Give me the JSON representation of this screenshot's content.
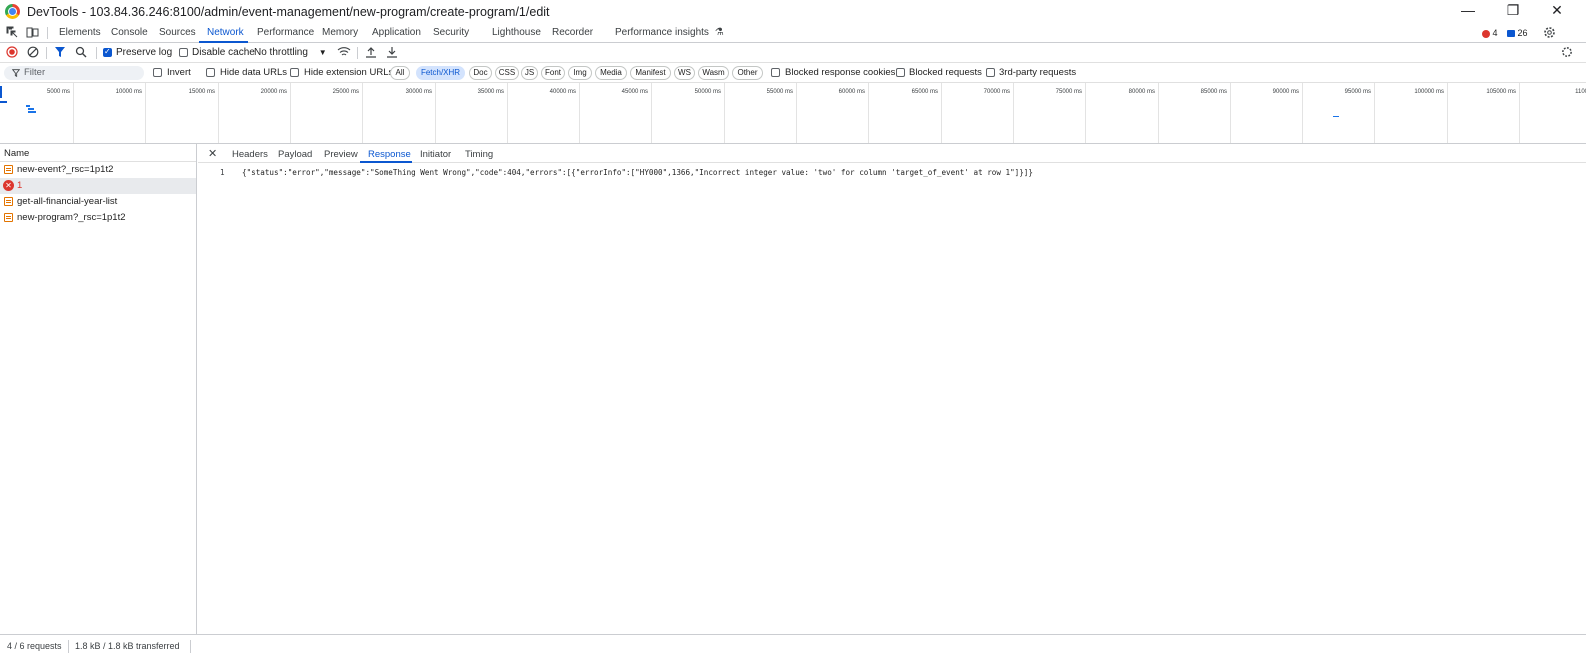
{
  "window": {
    "title": "DevTools - 103.84.36.246:8100/admin/event-management/new-program/create-program/1/edit",
    "minimize_glyph": "—",
    "restore_glyph": "❐",
    "close_glyph": "✕"
  },
  "main_tabs": [
    {
      "label": "Elements"
    },
    {
      "label": "Console"
    },
    {
      "label": "Sources"
    },
    {
      "label": "Network",
      "active": true
    },
    {
      "label": "Performance"
    },
    {
      "label": "Memory"
    },
    {
      "label": "Application"
    },
    {
      "label": "Security"
    },
    {
      "label": "Lighthouse"
    },
    {
      "label": "Recorder"
    },
    {
      "label": "Performance insights"
    }
  ],
  "badges": {
    "errors": "4",
    "messages": "26"
  },
  "toolbar": {
    "preserve_log": "Preserve log",
    "disable_cache": "Disable cache",
    "throttling": "No throttling"
  },
  "filter": {
    "placeholder": "Filter",
    "invert": "Invert",
    "hide_data_urls": "Hide data URLs",
    "hide_extension_urls": "Hide extension URLs",
    "types": [
      "All",
      "Fetch/XHR",
      "Doc",
      "CSS",
      "JS",
      "Font",
      "Img",
      "Media",
      "Manifest",
      "WS",
      "Wasm",
      "Other"
    ],
    "selected_type": "Fetch/XHR",
    "blocked_response_cookies": "Blocked response cookies",
    "blocked_requests": "Blocked requests",
    "third_party": "3rd-party requests"
  },
  "timeline_ticks": [
    "5000 ms",
    "10000 ms",
    "15000 ms",
    "20000 ms",
    "25000 ms",
    "30000 ms",
    "35000 ms",
    "40000 ms",
    "45000 ms",
    "50000 ms",
    "55000 ms",
    "60000 ms",
    "65000 ms",
    "70000 ms",
    "75000 ms",
    "80000 ms",
    "85000 ms",
    "90000 ms",
    "95000 ms",
    "100000 ms",
    "105000 ms",
    "1100"
  ],
  "requests": {
    "header": "Name",
    "rows": [
      {
        "name": "new-event?_rsc=1p1t2",
        "type": "xhr"
      },
      {
        "name": "1",
        "type": "error",
        "selected": true
      },
      {
        "name": "get-all-financial-year-list",
        "type": "xhr"
      },
      {
        "name": "new-program?_rsc=1p1t2",
        "type": "xhr"
      }
    ]
  },
  "detail_tabs": [
    {
      "label": "Headers"
    },
    {
      "label": "Payload"
    },
    {
      "label": "Preview"
    },
    {
      "label": "Response",
      "active": true
    },
    {
      "label": "Initiator"
    },
    {
      "label": "Timing"
    }
  ],
  "response": {
    "line_number": "1",
    "body": "{\"status\":\"error\",\"message\":\"SomeThing Went Wrong\",\"code\":404,\"errors\":[{\"errorInfo\":[\"HY000\",1366,\"Incorrect integer value: 'two' for column 'target_of_event' at row 1\"]}]}"
  },
  "status": {
    "requests": "4 / 6 requests",
    "transferred": "1.8 kB / 1.8 kB transferred"
  },
  "colors": {
    "accent": "#0b57d0",
    "error": "#dc362e",
    "xhr_icon": "#e37400"
  }
}
